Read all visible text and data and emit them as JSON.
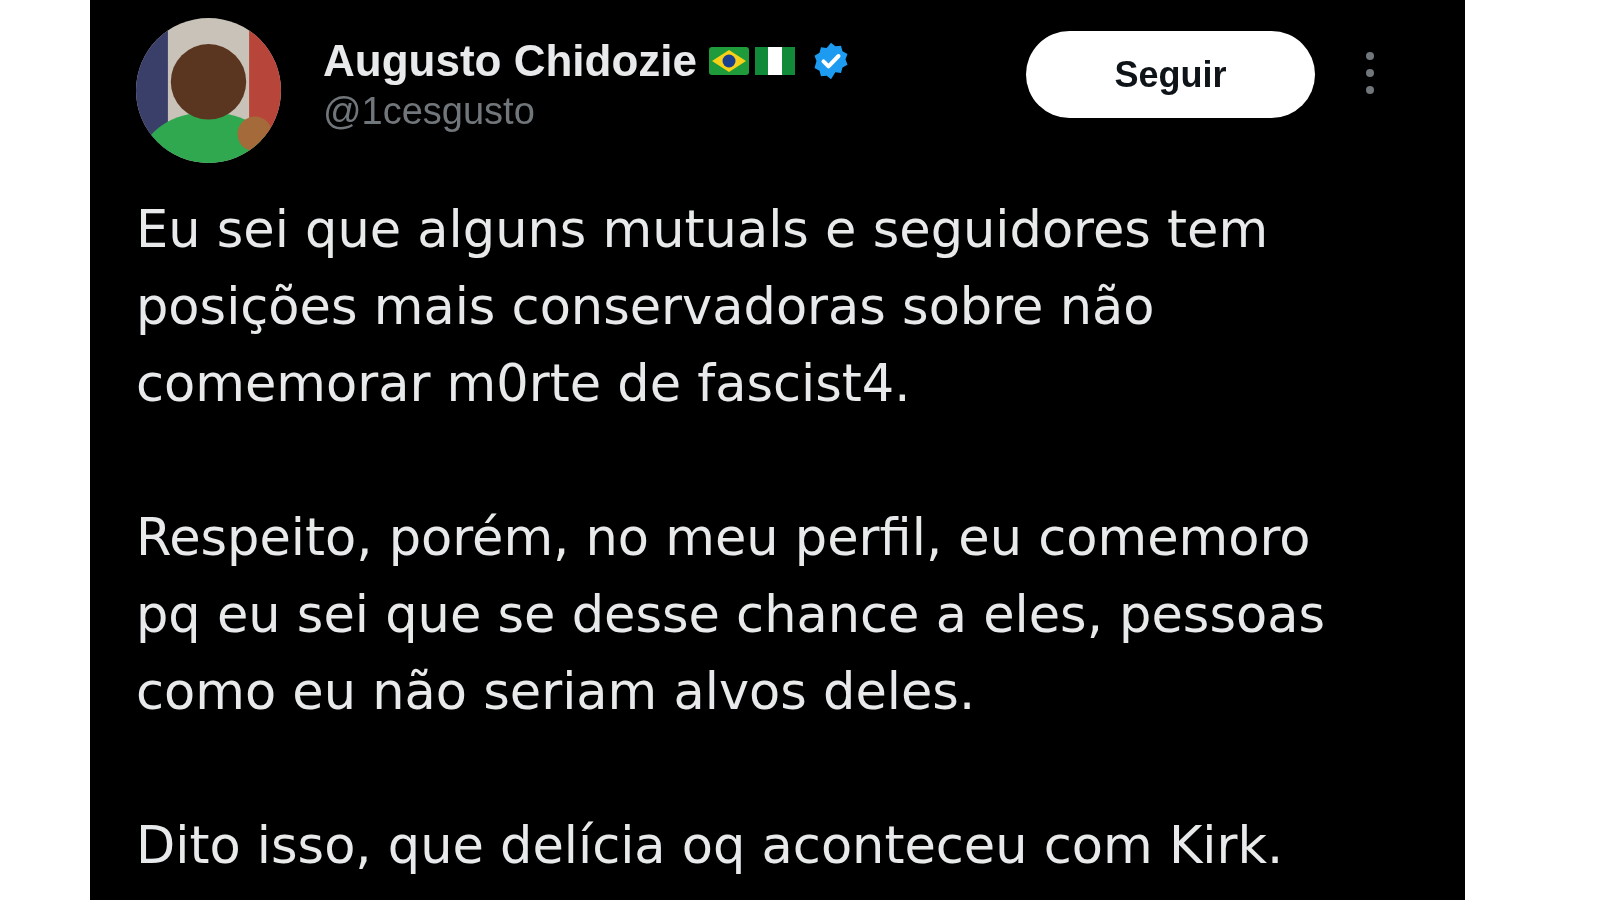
{
  "post": {
    "author": {
      "name": "Augusto Chidozie",
      "handle": "@1cesgusto",
      "verified": true
    },
    "follow_button": "Seguir",
    "paragraphs": [
      "Eu sei que alguns mutuals e seguidores tem posições mais conservadoras sobre não comemorar m0rte de fascist4.",
      "Respeito, porém, no meu perfil, eu comemoro pq eu sei que se desse chance a eles, pessoas como eu não seriam alvos deles.",
      "Dito isso, que delícia oq aconteceu com Kirk."
    ]
  }
}
